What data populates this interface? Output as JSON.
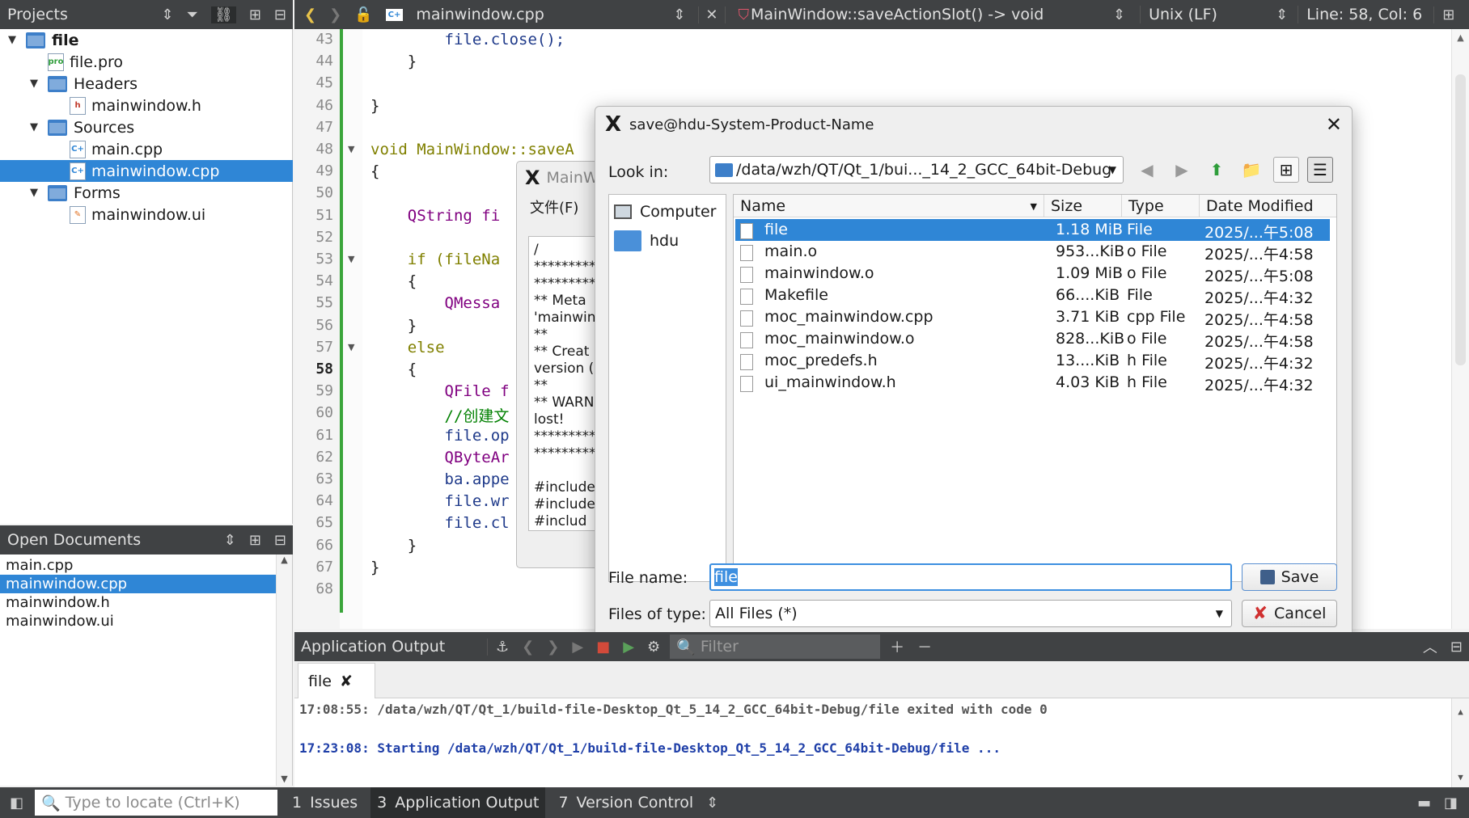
{
  "projects_pane": {
    "title": "Projects",
    "tree": [
      {
        "label": "file",
        "level": 0,
        "kind": "project",
        "expanded": true
      },
      {
        "label": "file.pro",
        "level": 1,
        "kind": "pro"
      },
      {
        "label": "Headers",
        "level": 1,
        "kind": "folder",
        "expanded": true
      },
      {
        "label": "mainwindow.h",
        "level": 2,
        "kind": "h"
      },
      {
        "label": "Sources",
        "level": 1,
        "kind": "folder",
        "expanded": true
      },
      {
        "label": "main.cpp",
        "level": 2,
        "kind": "cpp"
      },
      {
        "label": "mainwindow.cpp",
        "level": 2,
        "kind": "cpp",
        "selected": true
      },
      {
        "label": "Forms",
        "level": 1,
        "kind": "folder",
        "expanded": true
      },
      {
        "label": "mainwindow.ui",
        "level": 2,
        "kind": "ui"
      }
    ]
  },
  "open_documents": {
    "title": "Open Documents",
    "items": [
      "main.cpp",
      "mainwindow.cpp",
      "mainwindow.h",
      "mainwindow.ui"
    ],
    "selected": "mainwindow.cpp"
  },
  "editor_toolbar": {
    "file": "mainwindow.cpp",
    "symbol": "MainWindow::saveActionSlot() -> void",
    "line_endings": "Unix (LF)",
    "position": "Line: 58, Col: 6"
  },
  "code": {
    "current_line": 58,
    "lines": [
      {
        "n": 43,
        "text": "        file.close();"
      },
      {
        "n": 44,
        "text": "    }"
      },
      {
        "n": 45,
        "text": ""
      },
      {
        "n": 46,
        "text": "}"
      },
      {
        "n": 47,
        "text": ""
      },
      {
        "n": 48,
        "text": "void MainWindow::saveA",
        "fold": true
      },
      {
        "n": 49,
        "text": "{"
      },
      {
        "n": 50,
        "text": ""
      },
      {
        "n": 51,
        "text": "    QString fi"
      },
      {
        "n": 52,
        "text": ""
      },
      {
        "n": 53,
        "text": "    if (fileNa",
        "fold": true
      },
      {
        "n": 54,
        "text": "    {"
      },
      {
        "n": 55,
        "text": "        QMessa"
      },
      {
        "n": 56,
        "text": "    }"
      },
      {
        "n": 57,
        "text": "    else",
        "fold": true
      },
      {
        "n": 58,
        "text": "    {"
      },
      {
        "n": 59,
        "text": "        QFile f"
      },
      {
        "n": 60,
        "text": "        //创建文"
      },
      {
        "n": 61,
        "text": "        file.op"
      },
      {
        "n": 62,
        "text": "        QByteAr"
      },
      {
        "n": 63,
        "text": "        ba.appe"
      },
      {
        "n": 64,
        "text": "        file.wr"
      },
      {
        "n": 65,
        "text": "        file.cl"
      },
      {
        "n": 66,
        "text": "    }"
      },
      {
        "n": 67,
        "text": "}"
      },
      {
        "n": 68,
        "text": ""
      }
    ]
  },
  "app_window": {
    "title": "MainW",
    "menu": "文件(F)",
    "text_lines": [
      "/",
      "**********",
      "**********",
      "** Meta",
      "'mainwin",
      "**",
      "** Creat",
      "version (",
      "**",
      "** WARN",
      "lost!",
      "**********",
      "**********",
      "",
      "#include",
      "#include",
      "#includ"
    ]
  },
  "save_dialog": {
    "title": "save@hdu-System-Product-Name",
    "look_in_label": "Look in:",
    "look_in_path": "/data/wzh/QT/Qt_1/bui..._14_2_GCC_64bit-Debug",
    "places": [
      "Computer",
      "hdu"
    ],
    "columns": [
      "Name",
      "Size",
      "Type",
      "Date Modified"
    ],
    "files": [
      {
        "name": "file",
        "size": "1.18 MiB",
        "type": "File",
        "date": "2025/...午5:08",
        "selected": true
      },
      {
        "name": "main.o",
        "size": "953...KiB",
        "type": "o File",
        "date": "2025/...午4:58"
      },
      {
        "name": "mainwindow.o",
        "size": "1.09 MiB",
        "type": "o File",
        "date": "2025/...午5:08"
      },
      {
        "name": "Makefile",
        "size": "66....KiB",
        "type": "File",
        "date": "2025/...午4:32"
      },
      {
        "name": "moc_mainwindow.cpp",
        "size": "3.71 KiB",
        "type": "cpp File",
        "date": "2025/...午4:58"
      },
      {
        "name": "moc_mainwindow.o",
        "size": "828...KiB",
        "type": "o File",
        "date": "2025/...午4:58"
      },
      {
        "name": "moc_predefs.h",
        "size": "13....KiB",
        "type": "h File",
        "date": "2025/...午4:32"
      },
      {
        "name": "ui_mainwindow.h",
        "size": "4.03 KiB",
        "type": "h File",
        "date": "2025/...午4:32"
      }
    ],
    "file_name_label": "File name:",
    "file_name_value": "file",
    "files_of_type_label": "Files of type:",
    "files_of_type_value": "All Files (*)",
    "save_label": "Save",
    "cancel_label": "Cancel"
  },
  "output_pane": {
    "title": "Application Output",
    "filter_placeholder": "Filter",
    "tab": "file",
    "lines": [
      {
        "text": "17:08:55: /data/wzh/QT/Qt_1/build-file-Desktop_Qt_5_14_2_GCC_64bit-Debug/file exited with code 0",
        "bold": false
      },
      {
        "text": "17:23:08: Starting /data/wzh/QT/Qt_1/build-file-Desktop_Qt_5_14_2_GCC_64bit-Debug/file ...",
        "bold": true
      }
    ]
  },
  "status_bar": {
    "locate_placeholder": "Type to locate (Ctrl+K)",
    "tabs": [
      {
        "num": "1",
        "label": "Issues"
      },
      {
        "num": "3",
        "label": "Application Output"
      },
      {
        "num": "7",
        "label": "Version Control"
      }
    ]
  },
  "colors": {
    "selection": "#2f86d6",
    "dark_bar": "#404244",
    "keyword": "#808000",
    "type": "#800080",
    "function": "#00677c",
    "comment": "#008000"
  }
}
